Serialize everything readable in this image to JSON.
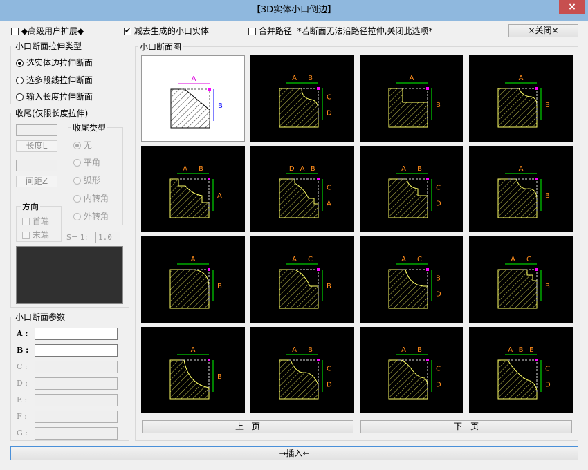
{
  "window": {
    "title": "【3D实体小口倒边】",
    "close_glyph": "×"
  },
  "top": {
    "advanced": {
      "label": "◆高级用户扩展◆",
      "checked": false
    },
    "subtract": {
      "label": "减去生成的小口实体",
      "checked": true
    },
    "merge": {
      "label": "合并路径",
      "checked": false
    },
    "note": "*若断面无法沿路径拉伸,关闭此选项*",
    "close_button": "×关闭×"
  },
  "extrude_type": {
    "title": "小口断面拉伸类型",
    "options": [
      {
        "label": "选实体边拉伸断面",
        "checked": true
      },
      {
        "label": "选多段线拉伸断面",
        "checked": false
      },
      {
        "label": "输入长度拉伸断面",
        "checked": false
      }
    ]
  },
  "ending": {
    "title": "收尾(仅限长度拉伸)",
    "length_button": "长度L",
    "spacing_button": "间距Z",
    "type_title": "收尾类型",
    "types": [
      {
        "label": "无",
        "checked": true
      },
      {
        "label": "平角",
        "checked": false
      },
      {
        "label": "弧形",
        "checked": false
      },
      {
        "label": "内转角",
        "checked": false
      },
      {
        "label": "外转角",
        "checked": false
      }
    ],
    "direction_title": "方向",
    "directions": [
      {
        "label": "首端"
      },
      {
        "label": "末端"
      }
    ],
    "scale_label": "S= 1:",
    "scale_value": "1.0"
  },
  "params": {
    "title": "小口断面参数",
    "fields": [
      {
        "label": "A :",
        "enabled": true
      },
      {
        "label": "B :",
        "enabled": true
      },
      {
        "label": "C :",
        "enabled": false
      },
      {
        "label": "D :",
        "enabled": false
      },
      {
        "label": "E :",
        "enabled": false
      },
      {
        "label": "F :",
        "enabled": false
      },
      {
        "label": "G :",
        "enabled": false
      }
    ]
  },
  "gallery": {
    "title": "小口断面图",
    "prev_button": "上一页",
    "next_button": "下一页",
    "cells": [
      {
        "id": 1,
        "profile": "chamfer",
        "labels": [
          "A",
          "B"
        ]
      },
      {
        "id": 2,
        "profile": "ogee",
        "labels": [
          "A",
          "B",
          "C",
          "D"
        ]
      },
      {
        "id": 3,
        "profile": "rect-notch",
        "labels": [
          "A",
          "B"
        ]
      },
      {
        "id": 4,
        "profile": "cove-fillet",
        "labels": [
          "A",
          "B"
        ]
      },
      {
        "id": 5,
        "profile": "stepped-arc",
        "labels": [
          "A",
          "B",
          "A"
        ]
      },
      {
        "id": 6,
        "profile": "double-step",
        "labels": [
          "D",
          "A",
          "B",
          "C",
          "A"
        ]
      },
      {
        "id": 7,
        "profile": "cove-step",
        "labels": [
          "A",
          "B",
          "C",
          "D"
        ]
      },
      {
        "id": 8,
        "profile": "wave",
        "labels": [
          "A",
          "B"
        ]
      },
      {
        "id": 9,
        "profile": "quarter-round",
        "labels": [
          "A",
          "B"
        ]
      },
      {
        "id": 10,
        "profile": "arc-step",
        "labels": [
          "A",
          "C",
          "B"
        ]
      },
      {
        "id": 11,
        "profile": "cove-corner",
        "labels": [
          "A",
          "C",
          "B",
          "D"
        ]
      },
      {
        "id": 12,
        "profile": "small-step",
        "labels": [
          "A",
          "C",
          "B"
        ]
      },
      {
        "id": 13,
        "profile": "large-cove",
        "labels": [
          "A",
          "B"
        ]
      },
      {
        "id": 14,
        "profile": "ogee-2",
        "labels": [
          "A",
          "B",
          "C",
          "D"
        ]
      },
      {
        "id": 15,
        "profile": "bead-cove",
        "labels": [
          "A",
          "B",
          "C",
          "D"
        ]
      },
      {
        "id": 16,
        "profile": "triple",
        "labels": [
          "A",
          "B",
          "E",
          "C",
          "D"
        ]
      }
    ]
  },
  "insert_button": "→插入←",
  "colors": {
    "dim": "#00ff00",
    "label": "#ff8c1a",
    "outline": "#ffff66",
    "point": "#ff00ff",
    "first_dim": "#dd00dd",
    "first_dim2": "#0000ff"
  }
}
